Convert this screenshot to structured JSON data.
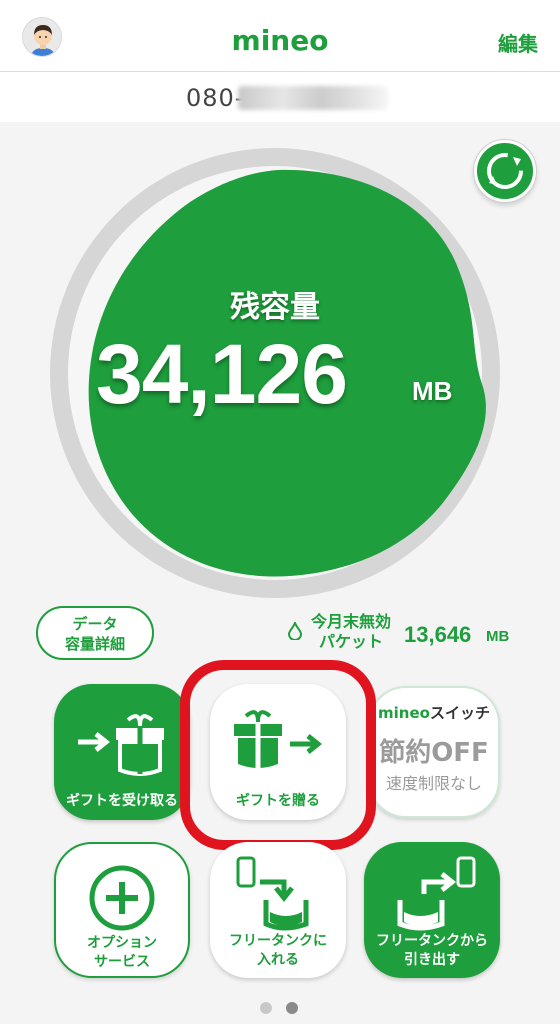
{
  "header": {
    "logo": "mineo",
    "edit_label": "編集"
  },
  "phone": {
    "visible_prefix": "080-"
  },
  "gauge": {
    "label": "残容量",
    "value": "34,126",
    "unit": "MB",
    "color": "#1e9e3c"
  },
  "data_detail": {
    "line1": "データ",
    "line2": "容量詳細"
  },
  "expiring": {
    "line1": "今月末無効",
    "line2": "パケット",
    "value": "13,646",
    "unit": "MB"
  },
  "tiles": {
    "receive_gift": "ギフトを受け取る",
    "send_gift": "ギフトを贈る",
    "switch_brand": "mineo",
    "switch_title": "スイッチ",
    "switch_state": "節約OFF",
    "switch_desc": "速度制限なし",
    "option_line1": "オプション",
    "option_line2": "サービス",
    "tank_in_line1": "フリータンクに",
    "tank_in_line2": "入れる",
    "tank_out_line1": "フリータンクから",
    "tank_out_line2": "引き出す"
  },
  "pager": {
    "pages": 2,
    "current": 2
  },
  "colors": {
    "brand": "#1e9e3c",
    "highlight": "#e0141e",
    "background": "#f4f4f4"
  }
}
